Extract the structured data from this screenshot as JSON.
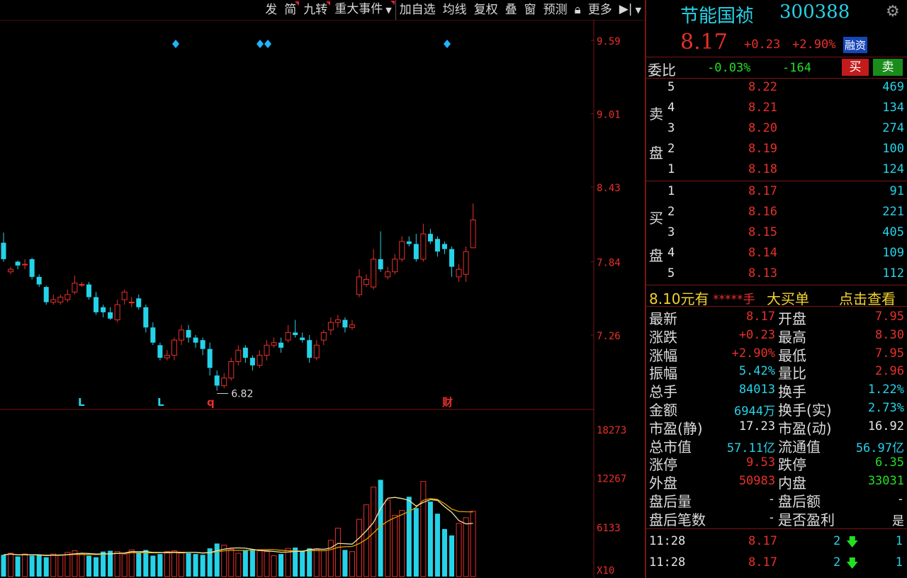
{
  "toolbar": {
    "items": [
      "发",
      "简",
      "九转",
      "重大事件",
      "加自选",
      "均线",
      "复权",
      "叠",
      "窗",
      "预测",
      "更多"
    ],
    "flags": [
      false,
      true,
      true,
      true,
      false,
      false,
      false,
      false,
      false,
      false,
      false
    ]
  },
  "stock": {
    "name": "节能国祯",
    "code": "300388",
    "price": "8.17",
    "change": "+0.23",
    "change_pct": "+2.90%",
    "badge": "融资"
  },
  "weibi": {
    "label": "委比",
    "pct": "-0.03%",
    "diff": "-164",
    "buy_label": "买",
    "sell_label": "卖"
  },
  "asks": [
    {
      "level": "5",
      "price": "8.22",
      "vol": "469"
    },
    {
      "level": "4",
      "price": "8.21",
      "vol": "134"
    },
    {
      "level": "3",
      "price": "8.20",
      "vol": "274"
    },
    {
      "level": "2",
      "price": "8.19",
      "vol": "100"
    },
    {
      "level": "1",
      "price": "8.18",
      "vol": "124"
    }
  ],
  "bids": [
    {
      "level": "1",
      "price": "8.17",
      "vol": "91"
    },
    {
      "level": "2",
      "price": "8.16",
      "vol": "221"
    },
    {
      "level": "3",
      "price": "8.15",
      "vol": "405"
    },
    {
      "level": "4",
      "price": "8.14",
      "vol": "109"
    },
    {
      "level": "5",
      "price": "8.13",
      "vol": "112"
    }
  ],
  "ask_side_label": [
    "卖",
    "盘"
  ],
  "bid_side_label": [
    "买",
    "盘"
  ],
  "big_order": {
    "price": "8.10元有",
    "hands": "*****手",
    "text": "大买单",
    "link": "点击查看"
  },
  "stats": [
    {
      "l1": "最新",
      "v1": "8.17",
      "c1": "red",
      "l2": "开盘",
      "v2": "7.95",
      "c2": "red"
    },
    {
      "l1": "涨跌",
      "v1": "+0.23",
      "c1": "red",
      "l2": "最高",
      "v2": "8.30",
      "c2": "red"
    },
    {
      "l1": "涨幅",
      "v1": "+2.90%",
      "c1": "red",
      "l2": "最低",
      "v2": "7.95",
      "c2": "red"
    },
    {
      "l1": "振幅",
      "v1": "5.42%",
      "c1": "cyan",
      "l2": "量比",
      "v2": "2.96",
      "c2": "red"
    },
    {
      "l1": "总手",
      "v1": "84013",
      "c1": "cyan",
      "l2": "换手",
      "v2": "1.22%",
      "c2": "cyan"
    },
    {
      "l1": "金额",
      "v1": "6944万",
      "c1": "cyan",
      "l2": "换手(实)",
      "v2": "2.73%",
      "c2": "cyan"
    },
    {
      "l1": "市盈(静)",
      "v1": "17.23",
      "c1": "white",
      "l2": "市盈(动)",
      "v2": "16.92",
      "c2": "white"
    },
    {
      "l1": "总市值",
      "v1": "57.11亿",
      "c1": "cyan",
      "l2": "流通值",
      "v2": "56.97亿",
      "c2": "cyan"
    },
    {
      "l1": "涨停",
      "v1": "9.53",
      "c1": "red",
      "l2": "跌停",
      "v2": "6.35",
      "c2": "green"
    },
    {
      "l1": "外盘",
      "v1": "50983",
      "c1": "red",
      "l2": "内盘",
      "v2": "33031",
      "c2": "green"
    },
    {
      "l1": "盘后量",
      "v1": "-",
      "c1": "white",
      "l2": "盘后额",
      "v2": "-",
      "c2": "white"
    },
    {
      "l1": "盘后笔数",
      "v1": "-",
      "c1": "white",
      "l2": "是否盈利",
      "v2": "是",
      "c2": "white"
    }
  ],
  "ticks": [
    {
      "time": "11:28",
      "price": "8.17",
      "count": "2",
      "n": "1"
    },
    {
      "time": "11:28",
      "price": "8.17",
      "count": "2",
      "n": "1"
    }
  ],
  "chart_data": {
    "type": "candlestick",
    "price_axis_labels": [
      "9.59",
      "9.01",
      "8.43",
      "7.84",
      "7.26"
    ],
    "price_axis_values": [
      9.59,
      9.01,
      8.43,
      7.84,
      7.26
    ],
    "volume_axis_labels": [
      "18273",
      "12267",
      "6133"
    ],
    "volume_axis_values": [
      18273,
      12267,
      6133
    ],
    "volume_unit": "X10",
    "min_label": "6.82",
    "event_markers": [
      "L",
      "L",
      "q",
      "财"
    ],
    "candles": [
      {
        "o": 7.99,
        "c": 7.86,
        "h": 8.07,
        "l": 7.84
      },
      {
        "o": 7.76,
        "c": 7.78,
        "h": 7.8,
        "l": 7.74
      },
      {
        "o": 7.84,
        "c": 7.81,
        "h": 7.85,
        "l": 7.78
      },
      {
        "o": 7.82,
        "c": 7.82,
        "h": 7.86,
        "l": 7.78
      },
      {
        "o": 7.86,
        "c": 7.72,
        "h": 7.87,
        "l": 7.7
      },
      {
        "o": 7.72,
        "c": 7.66,
        "h": 7.74,
        "l": 7.64
      },
      {
        "o": 7.64,
        "c": 7.52,
        "h": 7.65,
        "l": 7.5
      },
      {
        "o": 7.52,
        "c": 7.54,
        "h": 7.58,
        "l": 7.5
      },
      {
        "o": 7.52,
        "c": 7.56,
        "h": 7.58,
        "l": 7.5
      },
      {
        "o": 7.54,
        "c": 7.58,
        "h": 7.62,
        "l": 7.52
      },
      {
        "o": 7.6,
        "c": 7.67,
        "h": 7.73,
        "l": 7.58
      },
      {
        "o": 7.66,
        "c": 7.66,
        "h": 7.68,
        "l": 7.64
      },
      {
        "o": 7.66,
        "c": 7.56,
        "h": 7.68,
        "l": 7.54
      },
      {
        "o": 7.56,
        "c": 7.44,
        "h": 7.6,
        "l": 7.42
      },
      {
        "o": 7.48,
        "c": 7.44,
        "h": 7.5,
        "l": 7.4
      },
      {
        "o": 7.44,
        "c": 7.39,
        "h": 7.48,
        "l": 7.38
      },
      {
        "o": 7.38,
        "c": 7.5,
        "h": 7.54,
        "l": 7.36
      },
      {
        "o": 7.54,
        "c": 7.6,
        "h": 7.62,
        "l": 7.5
      },
      {
        "o": 7.52,
        "c": 7.52,
        "h": 7.56,
        "l": 7.48
      },
      {
        "o": 7.55,
        "c": 7.48,
        "h": 7.58,
        "l": 7.46
      },
      {
        "o": 7.48,
        "c": 7.32,
        "h": 7.5,
        "l": 7.28
      },
      {
        "o": 7.32,
        "c": 7.2,
        "h": 7.36,
        "l": 7.18
      },
      {
        "o": 7.18,
        "c": 7.08,
        "h": 7.2,
        "l": 7.06
      },
      {
        "o": 7.08,
        "c": 7.1,
        "h": 7.14,
        "l": 7.06
      },
      {
        "o": 7.1,
        "c": 7.22,
        "h": 7.24,
        "l": 7.06
      },
      {
        "o": 7.22,
        "c": 7.3,
        "h": 7.34,
        "l": 7.18
      },
      {
        "o": 7.3,
        "c": 7.24,
        "h": 7.34,
        "l": 7.2
      },
      {
        "o": 7.24,
        "c": 7.2,
        "h": 7.26,
        "l": 7.16
      },
      {
        "o": 7.22,
        "c": 7.15,
        "h": 7.24,
        "l": 7.1
      },
      {
        "o": 7.15,
        "c": 7.0,
        "h": 7.2,
        "l": 6.94
      },
      {
        "o": 6.94,
        "c": 6.86,
        "h": 6.98,
        "l": 6.82
      },
      {
        "o": 6.86,
        "c": 6.92,
        "h": 6.96,
        "l": 6.84
      },
      {
        "o": 6.92,
        "c": 7.05,
        "h": 7.08,
        "l": 6.9
      },
      {
        "o": 7.05,
        "c": 7.14,
        "h": 7.18,
        "l": 7.02
      },
      {
        "o": 7.16,
        "c": 7.08,
        "h": 7.18,
        "l": 7.04
      },
      {
        "o": 7.08,
        "c": 7.02,
        "h": 7.1,
        "l": 6.98
      },
      {
        "o": 7.02,
        "c": 7.1,
        "h": 7.14,
        "l": 7.0
      },
      {
        "o": 7.1,
        "c": 7.18,
        "h": 7.22,
        "l": 7.06
      },
      {
        "o": 7.18,
        "c": 7.2,
        "h": 7.24,
        "l": 7.16
      },
      {
        "o": 7.2,
        "c": 7.16,
        "h": 7.24,
        "l": 7.12
      },
      {
        "o": 7.22,
        "c": 7.28,
        "h": 7.34,
        "l": 7.2
      },
      {
        "o": 7.28,
        "c": 7.26,
        "h": 7.38,
        "l": 7.24
      },
      {
        "o": 7.24,
        "c": 7.22,
        "h": 7.28,
        "l": 7.2
      },
      {
        "o": 7.22,
        "c": 7.08,
        "h": 7.26,
        "l": 7.04
      },
      {
        "o": 7.08,
        "c": 7.18,
        "h": 7.22,
        "l": 7.06
      },
      {
        "o": 7.22,
        "c": 7.28,
        "h": 7.3,
        "l": 7.18
      },
      {
        "o": 7.3,
        "c": 7.36,
        "h": 7.4,
        "l": 7.26
      },
      {
        "o": 7.36,
        "c": 7.38,
        "h": 7.42,
        "l": 7.32
      },
      {
        "o": 7.38,
        "c": 7.32,
        "h": 7.4,
        "l": 7.28
      },
      {
        "o": 7.32,
        "c": 7.34,
        "h": 7.38,
        "l": 7.3
      },
      {
        "o": 7.58,
        "c": 7.72,
        "h": 7.78,
        "l": 7.56
      },
      {
        "o": 7.66,
        "c": 7.7,
        "h": 7.74,
        "l": 7.64
      },
      {
        "o": 7.64,
        "c": 7.86,
        "h": 7.94,
        "l": 7.62
      },
      {
        "o": 7.86,
        "c": 7.78,
        "h": 8.08,
        "l": 7.76
      },
      {
        "o": 7.72,
        "c": 7.76,
        "h": 7.8,
        "l": 7.7
      },
      {
        "o": 7.76,
        "c": 7.86,
        "h": 7.9,
        "l": 7.74
      },
      {
        "o": 7.86,
        "c": 8.0,
        "h": 8.04,
        "l": 7.84
      },
      {
        "o": 8.0,
        "c": 7.98,
        "h": 8.04,
        "l": 7.96
      },
      {
        "o": 7.98,
        "c": 7.86,
        "h": 8.06,
        "l": 7.84
      },
      {
        "o": 7.86,
        "c": 8.06,
        "h": 8.14,
        "l": 7.84
      },
      {
        "o": 8.06,
        "c": 8.0,
        "h": 8.1,
        "l": 7.98
      },
      {
        "o": 8.02,
        "c": 7.92,
        "h": 8.04,
        "l": 7.88
      },
      {
        "o": 7.98,
        "c": 7.94,
        "h": 8.0,
        "l": 7.9
      },
      {
        "o": 7.94,
        "c": 7.8,
        "h": 7.96,
        "l": 7.72
      },
      {
        "o": 7.72,
        "c": 7.78,
        "h": 7.82,
        "l": 7.68
      },
      {
        "o": 7.74,
        "c": 7.92,
        "h": 7.96,
        "l": 7.68
      },
      {
        "o": 7.95,
        "c": 8.17,
        "h": 8.3,
        "l": 7.95
      }
    ],
    "volume": [
      2700,
      2900,
      2500,
      2800,
      2600,
      2700,
      2400,
      2800,
      2700,
      3000,
      3200,
      2800,
      2600,
      2400,
      3100,
      3200,
      3100,
      2800,
      3300,
      3000,
      3300,
      2600,
      2800,
      3100,
      3200,
      3000,
      2900,
      2800,
      2700,
      3500,
      4100,
      3900,
      3400,
      2900,
      3300,
      3400,
      3200,
      3100,
      2600,
      2800,
      3500,
      3600,
      3200,
      3500,
      3400,
      3200,
      4500,
      6000,
      3300,
      3100,
      7100,
      8900,
      11100,
      12000,
      9500,
      7600,
      8200,
      9900,
      8500,
      11800,
      9300,
      7800,
      5900,
      5100,
      6600,
      7300,
      8100
    ]
  }
}
